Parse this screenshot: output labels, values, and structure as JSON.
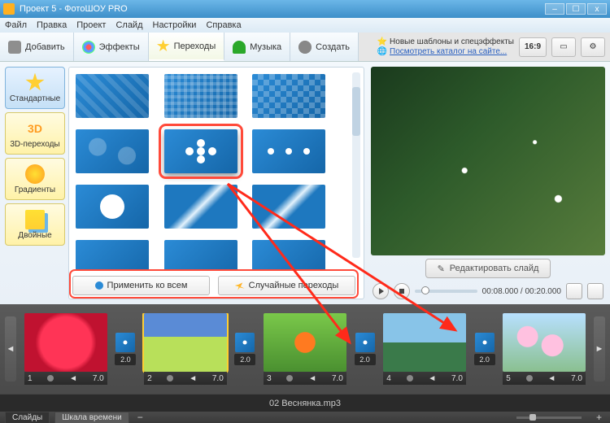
{
  "window": {
    "title": "Проект 5 - ФотоШОУ PRO"
  },
  "menu": [
    "Файл",
    "Правка",
    "Проект",
    "Слайд",
    "Настройки",
    "Справка"
  ],
  "tabs": {
    "add": "Добавить",
    "effects": "Эффекты",
    "transitions": "Переходы",
    "music": "Музыка",
    "create": "Создать"
  },
  "promo": {
    "line1": "Новые шаблоны и спецэффекты",
    "line2": "Посмотреть каталог на сайте..."
  },
  "aspect": "16:9",
  "categories": {
    "standard": "Стандартные",
    "three_d": "3D-переходы",
    "gradients": "Градиенты",
    "double": "Двойные",
    "three_d_icon": "3D"
  },
  "actions": {
    "apply_all": "Применить ко всем",
    "random": "Случайные переходы"
  },
  "preview": {
    "edit": "Редактировать слайд",
    "time_current": "00:08.000",
    "time_total": "00:20.000"
  },
  "timeline": {
    "transition_duration": "2.0",
    "clip_durations": [
      "7.0",
      "7.0",
      "7.0",
      "7.0",
      "7.0"
    ],
    "clip_numbers": [
      "1",
      "2",
      "3",
      "4",
      "5"
    ],
    "audio": "02 Веснянка.mp3"
  },
  "bottom_tabs": {
    "slides": "Слайды",
    "timescale": "Шкала времени"
  }
}
